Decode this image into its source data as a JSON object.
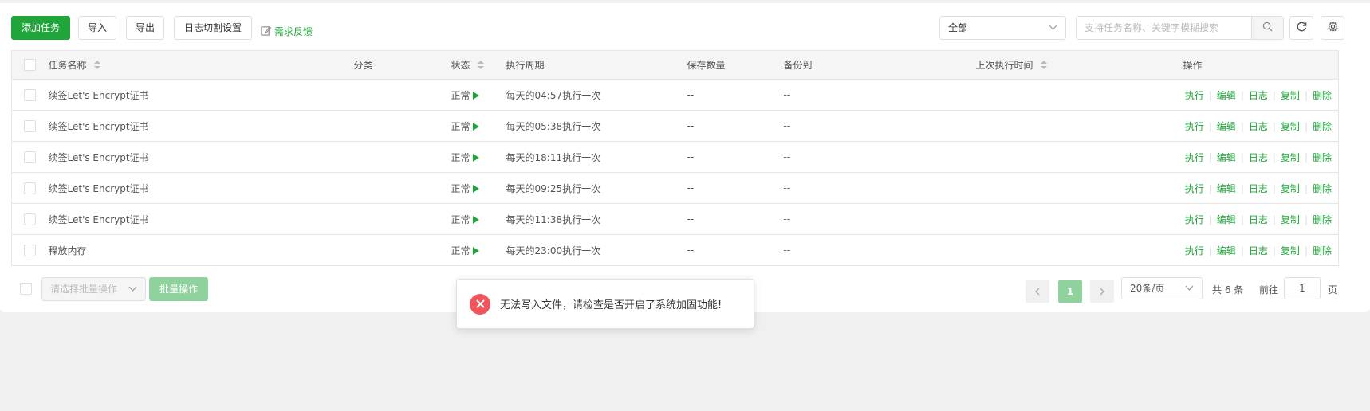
{
  "toolbar": {
    "add_task": "添加任务",
    "import": "导入",
    "export": "导出",
    "log_rotate": "日志切割设置",
    "feedback": "需求反馈",
    "filter_value": "全部",
    "search_placeholder": "支持任务名称、关键字模糊搜索"
  },
  "table": {
    "headers": {
      "name": "任务名称",
      "category": "分类",
      "status": "状态",
      "cycle": "执行周期",
      "save_count": "保存数量",
      "backup_to": "备份到",
      "last_run": "上次执行时间",
      "actions": "操作"
    },
    "rows": [
      {
        "name": "续签Let's Encrypt证书",
        "status": "正常",
        "cycle": "每天的04:57执行一次",
        "save_count": "--",
        "backup_to": "--"
      },
      {
        "name": "续签Let's Encrypt证书",
        "status": "正常",
        "cycle": "每天的05:38执行一次",
        "save_count": "--",
        "backup_to": "--"
      },
      {
        "name": "续签Let's Encrypt证书",
        "status": "正常",
        "cycle": "每天的18:11执行一次",
        "save_count": "--",
        "backup_to": "--"
      },
      {
        "name": "续签Let's Encrypt证书",
        "status": "正常",
        "cycle": "每天的09:25执行一次",
        "save_count": "--",
        "backup_to": "--"
      },
      {
        "name": "续签Let's Encrypt证书",
        "status": "正常",
        "cycle": "每天的11:38执行一次",
        "save_count": "--",
        "backup_to": "--"
      },
      {
        "name": "释放内存",
        "status": "正常",
        "cycle": "每天的23:00执行一次",
        "save_count": "--",
        "backup_to": "--"
      }
    ],
    "actions": [
      "执行",
      "编辑",
      "日志",
      "复制",
      "删除"
    ]
  },
  "footer": {
    "batch_placeholder": "请选择批量操作",
    "batch_button": "批量操作",
    "current_page": "1",
    "page_size": "20条/页",
    "total": "共 6 条",
    "goto_label": "前往",
    "goto_value": "1",
    "page_unit": "页"
  },
  "toast": {
    "message": "无法写入文件，请检查是否开启了系统加固功能!"
  },
  "colors": {
    "primary": "#20a53a",
    "primary_disabled": "#90d29d",
    "error": "#f2545b"
  }
}
